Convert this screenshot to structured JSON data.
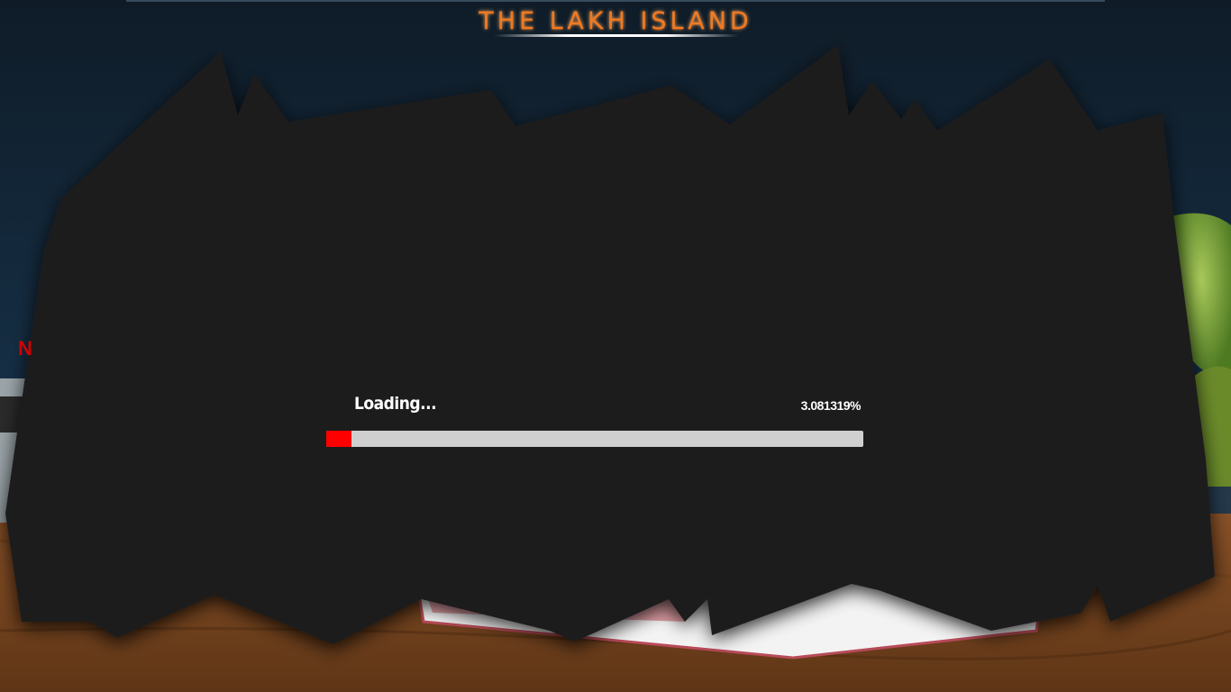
{
  "game": {
    "title": "THE LAKH ISLAND"
  },
  "loading": {
    "label": "Loading...",
    "percent_text": "3.081319%",
    "progress_fraction": 0.0308
  },
  "background": {
    "partial_letter": "N"
  },
  "colors": {
    "title": "#f07a22",
    "overlay": "#1e1e1e",
    "sky": "#10202e",
    "ground": "#7a4824",
    "progress_fill": "#ff0000",
    "progress_track": "#cfcfcf"
  }
}
